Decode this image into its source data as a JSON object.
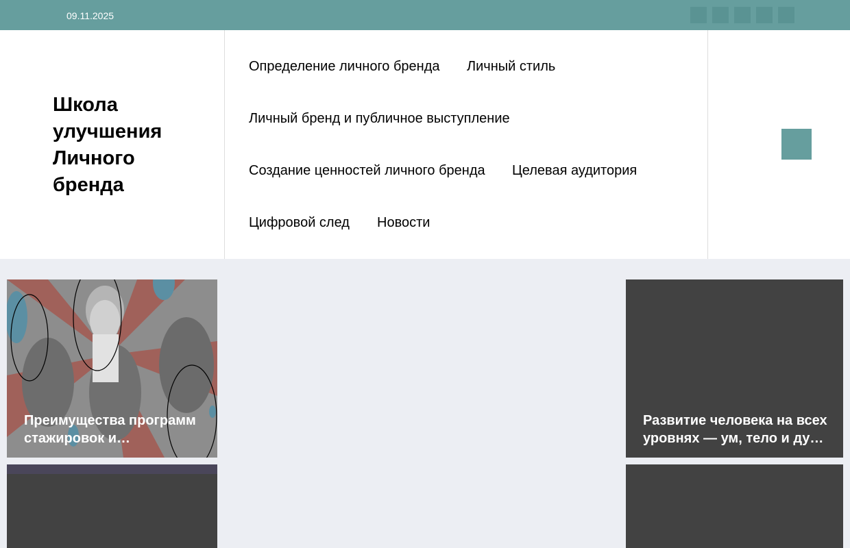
{
  "topbar": {
    "date": "09.11.2025",
    "social_icons": [
      "social-icon-1",
      "social-icon-2",
      "social-icon-3",
      "social-icon-4",
      "social-icon-5"
    ]
  },
  "header": {
    "site_title": "Школа улучшения Личного бренда",
    "nav": [
      {
        "label": "Определение личного бренда"
      },
      {
        "label": "Личный стиль"
      },
      {
        "label": "Личный бренд и публичное выступление"
      },
      {
        "label": "Создание ценностей личного бренда"
      },
      {
        "label": "Целевая аудитория"
      },
      {
        "label": "Цифровой след"
      },
      {
        "label": "Новости"
      }
    ],
    "menu_icon": "menu-icon"
  },
  "cards": [
    {
      "title": "Преимущества программ стажировок и…"
    },
    {
      "title": "Развитие человека на всех уровнях — ум, тело и ду…"
    },
    {
      "title": ""
    },
    {
      "title": ""
    }
  ],
  "colors": {
    "accent": "#669e9e",
    "page_background": "#eceef3",
    "card_dark": "#424242"
  }
}
